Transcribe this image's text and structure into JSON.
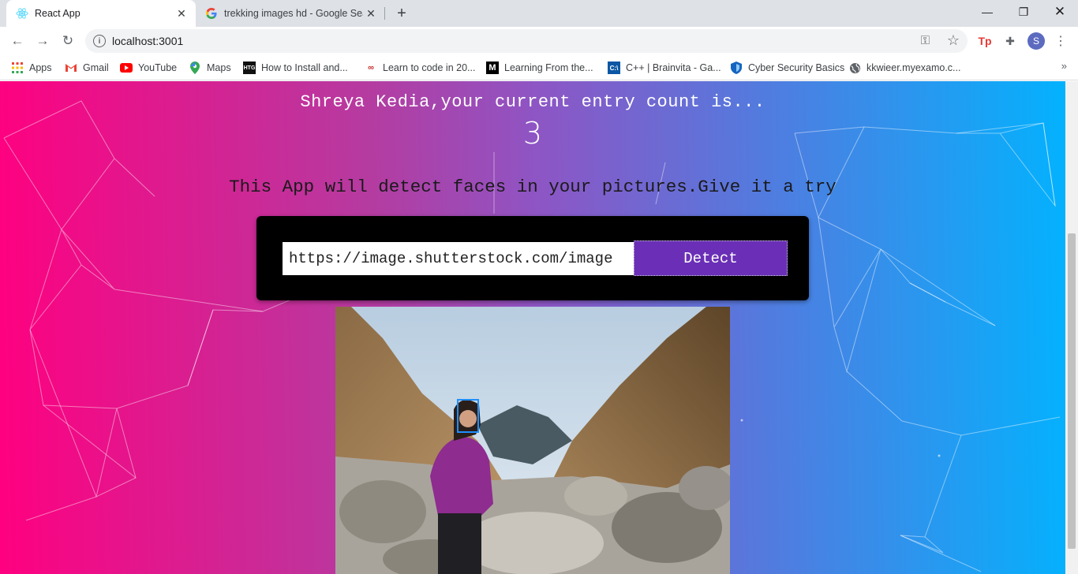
{
  "browser": {
    "tabs": [
      {
        "title": "React App",
        "active": true
      },
      {
        "title": "trekking images hd - Google Sea",
        "active": false
      }
    ],
    "url": "localhost:3001",
    "profile_initial": "S",
    "bookmarks": [
      {
        "label": "Apps",
        "icon": "apps-grid-icon"
      },
      {
        "label": "Gmail",
        "icon": "gmail-icon"
      },
      {
        "label": "YouTube",
        "icon": "youtube-icon"
      },
      {
        "label": "Maps",
        "icon": "maps-icon"
      },
      {
        "label": "How to Install and...",
        "icon": "htg-icon"
      },
      {
        "label": "Learn to code in 20...",
        "icon": "code-icon"
      },
      {
        "label": "Learning From the...",
        "icon": "medium-icon"
      },
      {
        "label": "C++ | Brainvita - Ga...",
        "icon": "cpp-icon"
      },
      {
        "label": "Cyber Security Basics",
        "icon": "shield-icon"
      },
      {
        "label": "kkwieer.myexamo.c...",
        "icon": "globe-icon"
      }
    ]
  },
  "app": {
    "greeting": "Shreya Kedia,your current entry count is...",
    "entry_count": "3",
    "tagline": "This App will detect faces in your pictures.Give it a try",
    "input_value": "https://image.shutterstock.com/image",
    "detect_label": "Detect"
  },
  "colors": {
    "gradient_left": "#ff0080",
    "gradient_right": "#00b4ff",
    "button": "#6a2fb6",
    "face_box": "#1e8fff"
  }
}
